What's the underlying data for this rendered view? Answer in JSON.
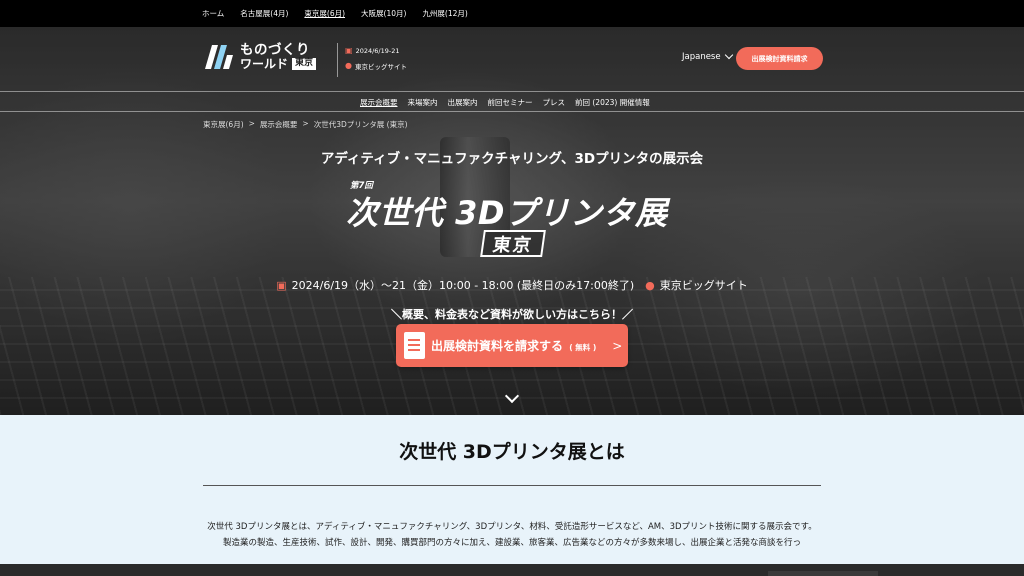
{
  "topnav": {
    "links": [
      {
        "label": "ホーム"
      },
      {
        "label": "名古屋展(4月)"
      },
      {
        "label": "東京展(6月)"
      },
      {
        "label": "大阪展(10月)"
      },
      {
        "label": "九州展(12月)"
      }
    ]
  },
  "logo": {
    "line1": "ものづくり",
    "line2": "ワールド",
    "city": "東京"
  },
  "event": {
    "dates": "2024/6/19-21",
    "venue": "東京ビッグサイト"
  },
  "header": {
    "language": "Japanese",
    "request_button": "出展検討資料請求"
  },
  "subnav": {
    "items": [
      {
        "label": "展示会概要"
      },
      {
        "label": "来場案内"
      },
      {
        "label": "出展案内"
      },
      {
        "label": "前回セミナー"
      },
      {
        "label": "プレス"
      },
      {
        "label": "前回 (2023) 開催情報"
      }
    ]
  },
  "breadcrumb": [
    "東京展(6月)",
    ">",
    "展示会概要",
    ">",
    "次世代3Dプリンタ展 (東京)"
  ],
  "hero": {
    "tagline": "アディティブ・マニュファクチャリング、3Dプリンタの展示会",
    "edition": "第7回",
    "title": "次世代 3Dプリンタ展",
    "city_badge": "東京",
    "dates_text": "2024/6/19（水）～21（金）10:00 - 18:00 (最終日のみ17:00終了)",
    "venue": "東京ビッグサイト",
    "cta_lead": "＼概要、料金表など資料が欲しい方はこちら！／",
    "cta_label": "出展検討資料を請求する",
    "cta_free": "( 無料 )",
    "cta_arrow": ">"
  },
  "about": {
    "heading": "次世代 3Dプリンタ展とは",
    "para1": "次世代 3Dプリンタ展とは、アディティブ・マニュファクチャリング、3Dプリンタ、材料、受託造形サービスなど、AM、3Dプリント技術に関する展示会です。",
    "para2": "製造業の製造、生産技術、試作、設計、開発、購買部門の方々に加え、建設業、旅客業、広告業などの方々が多数来場し、出展企業と活発な商談を行っ"
  },
  "colors": {
    "accent": "#f26b5a",
    "topbar": "#000000",
    "section_bg": "#e8f3fa"
  }
}
